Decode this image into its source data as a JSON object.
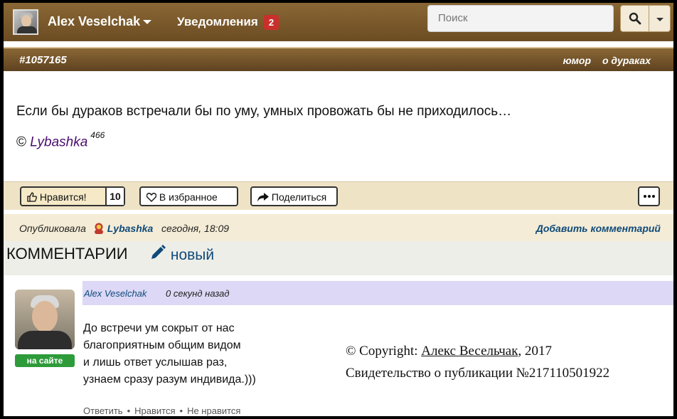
{
  "navbar": {
    "user_name": "Alex Veselchak",
    "notifications_label": "Уведомления",
    "notifications_count": "2",
    "search_placeholder": "Поиск"
  },
  "quote": {
    "id": "#1057165",
    "tags": [
      "юмор",
      "о дураках"
    ],
    "text": "Если бы дураков встречали бы по уму, умных провожать бы не приходилось…",
    "copyright_symbol": "©",
    "author": "Lybashka",
    "author_rating": "466"
  },
  "actions": {
    "like_label": "Нравится!",
    "like_count": "10",
    "favorite_label": "В избранное",
    "share_label": "Поделиться"
  },
  "published": {
    "prefix": "Опубликовала",
    "user": "Lybashka",
    "time": "сегодня, 18:09",
    "add_comment": "Добавить комментарий"
  },
  "comments": {
    "title": "КОММЕНТАРИИ",
    "new_label": "новый",
    "items": [
      {
        "author": "Alex Veselchak",
        "time": "0 секунд назад",
        "status": "на сайте",
        "lines": [
          "До встречи ум сокрыт от нас",
          "благоприятным общим видом",
          "и лишь ответ услышав раз,",
          "узнаем сразу разум индивида.)))"
        ],
        "reply": "Ответить",
        "like": "Нравится",
        "dislike": "Не нравится"
      }
    ]
  },
  "copyright": {
    "prefix": "© Copyright: ",
    "author": "Алекс Весельчак",
    "year": ", 2017",
    "certificate": "Свидетельство о публикации №217110501922"
  }
}
